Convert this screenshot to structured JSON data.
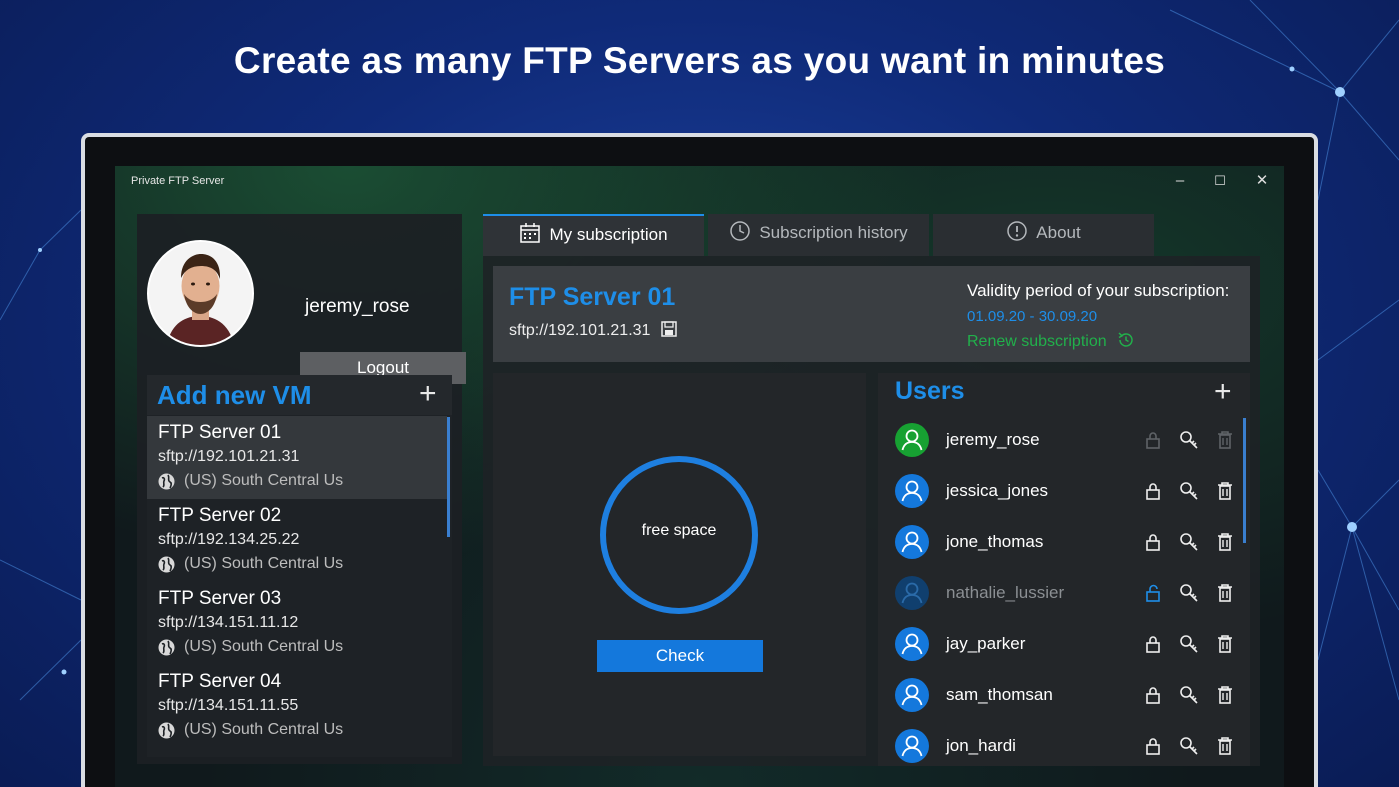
{
  "headline": "Create as many FTP Servers as you want in minutes",
  "window": {
    "title": "Private FTP Server",
    "minimize": "–",
    "maximize": "☐",
    "close": "✕"
  },
  "profile": {
    "username": "jeremy_rose",
    "logout_label": "Logout"
  },
  "vm_list": {
    "title": "Add new VM",
    "add_icon": "plus-icon",
    "items": [
      {
        "name": "FTP Server 01",
        "host": "sftp://192.101.21.31",
        "location": "(US) South Central Us",
        "selected": true
      },
      {
        "name": "FTP Server 02",
        "host": "sftp://192.134.25.22",
        "location": "(US) South Central Us",
        "selected": false
      },
      {
        "name": "FTP Server 03",
        "host": "sftp://134.151.11.12",
        "location": "(US) South Central Us",
        "selected": false
      },
      {
        "name": "FTP Server 04",
        "host": "sftp://134.151.11.55",
        "location": "(US) South Central Us",
        "selected": false
      }
    ]
  },
  "tabs": [
    {
      "label": "My subscription",
      "icon": "calendar-icon",
      "active": true
    },
    {
      "label": "Subscription history",
      "icon": "clock-icon",
      "active": false
    },
    {
      "label": "About",
      "icon": "info-icon",
      "active": false
    }
  ],
  "server": {
    "title": "FTP Server 01",
    "host": "sftp://192.101.21.31",
    "validity_label": "Validity period of your subscription:",
    "validity_dates": "01.09.20 - 30.09.20",
    "renew_label": "Renew subscription"
  },
  "space": {
    "ring_label": "free space",
    "check_label": "Check"
  },
  "users": {
    "title": "Users",
    "items": [
      {
        "name": "jeremy_rose",
        "avatar": "green",
        "lock": "dim",
        "delete": "dim"
      },
      {
        "name": "jessica_jones",
        "avatar": "blue",
        "lock": "normal",
        "delete": "normal"
      },
      {
        "name": "jone_thomas",
        "avatar": "blue",
        "lock": "normal",
        "delete": "normal"
      },
      {
        "name": "nathalie_lussier",
        "avatar": "dim",
        "lock": "open-blue",
        "delete": "normal"
      },
      {
        "name": "jay_parker",
        "avatar": "blue",
        "lock": "normal",
        "delete": "normal"
      },
      {
        "name": "sam_thomsan",
        "avatar": "blue",
        "lock": "normal",
        "delete": "normal"
      },
      {
        "name": "jon_hardi",
        "avatar": "blue",
        "lock": "normal",
        "delete": "normal"
      }
    ]
  },
  "colors": {
    "accent_blue": "#1e8ee8",
    "renew_green": "#21b04b",
    "active_user_green": "#17a132"
  }
}
